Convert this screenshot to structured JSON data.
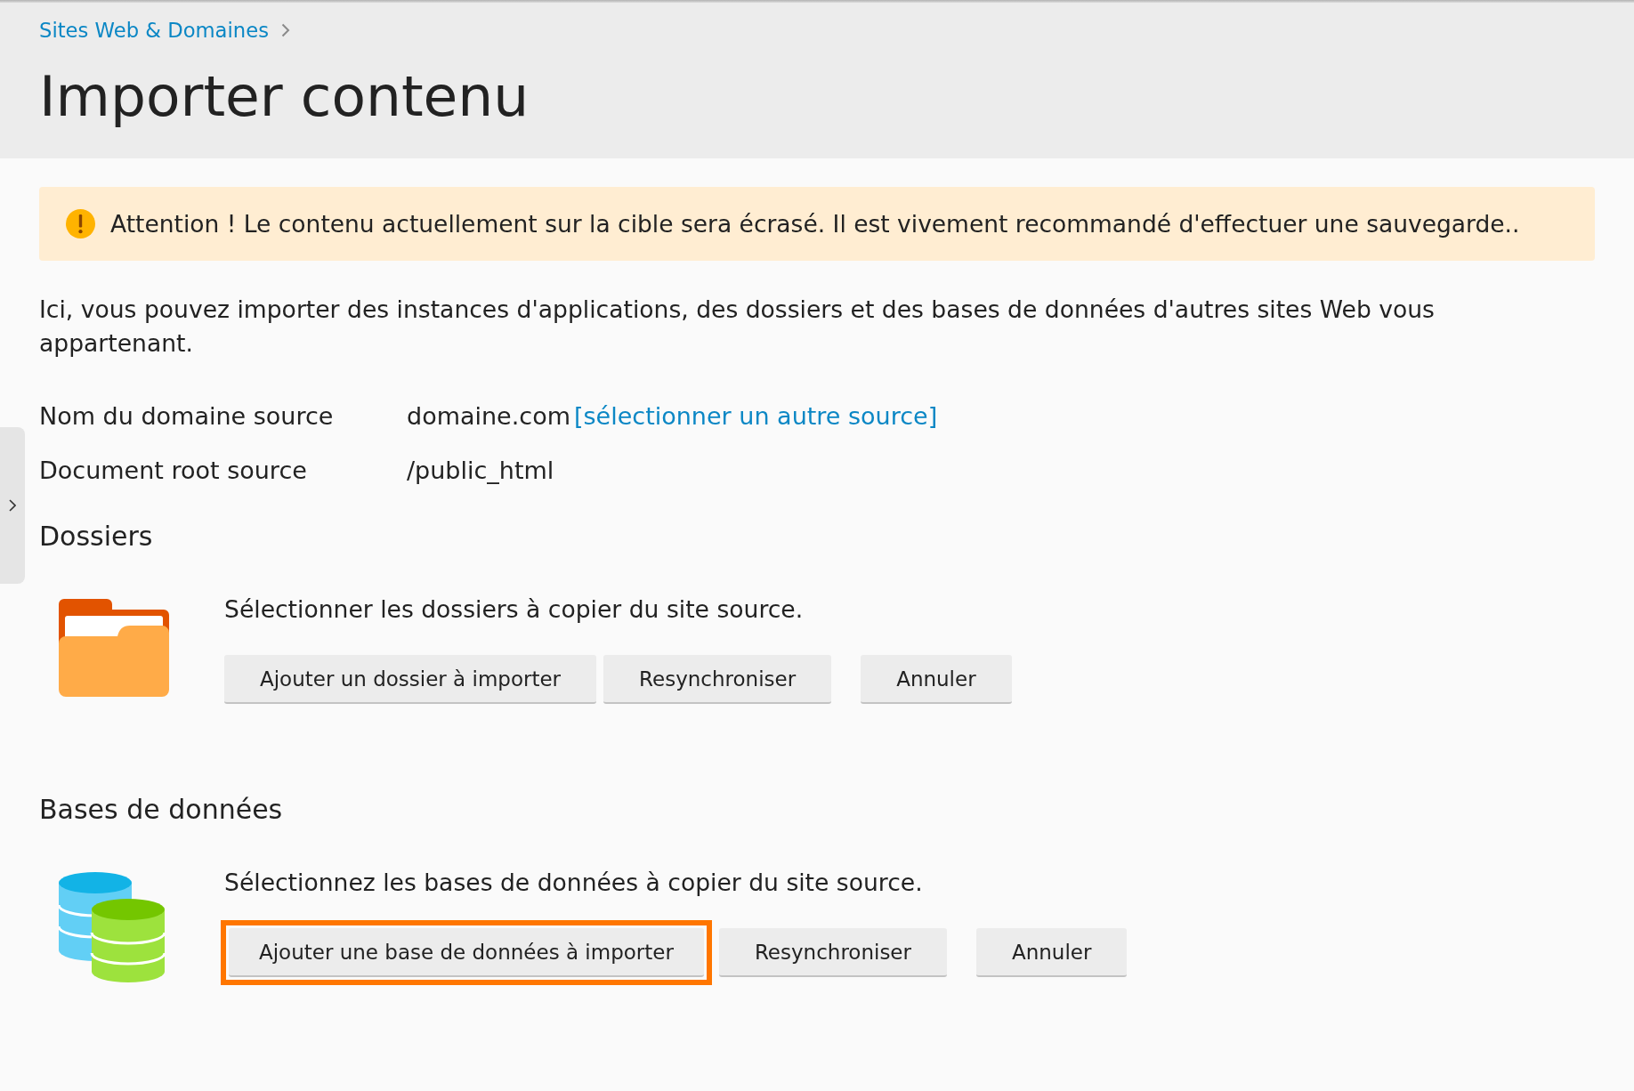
{
  "breadcrumb": [
    {
      "label": "Sites Web & Domaines"
    }
  ],
  "title": "Importer contenu",
  "warning": {
    "text": "Attention ! Le contenu actuellement sur la cible sera écrasé. Il est vivement recommandé d'effectuer une sauvegarde.."
  },
  "intro": "Ici, vous pouvez importer des instances d'applications, des dossiers et des bases de données d'autres sites Web vous appartenant.",
  "fields": [
    {
      "label": "Nom du domaine source",
      "value": "domaine.com",
      "link": "[sélectionner un autre source]"
    },
    {
      "label": "Document root source",
      "value": "/public_html"
    }
  ],
  "sections": [
    {
      "kind": "folders",
      "title": "Dossiers",
      "description": "Sélectionner les dossiers à copier du site source.",
      "buttons": [
        {
          "label": "Ajouter un dossier à importer",
          "highlighted": false
        },
        {
          "label": "Resynchroniser",
          "highlighted": false
        }
      ],
      "cancel_button": {
        "label": "Annuler"
      }
    },
    {
      "kind": "databases",
      "title": "Bases de données",
      "description": "Sélectionnez les bases de données à copier du site source.",
      "buttons": [
        {
          "label": "Ajouter une base de données à importer",
          "highlighted": true
        },
        {
          "label": "Resynchroniser",
          "highlighted": false
        }
      ],
      "cancel_button": {
        "label": "Annuler"
      }
    }
  ]
}
